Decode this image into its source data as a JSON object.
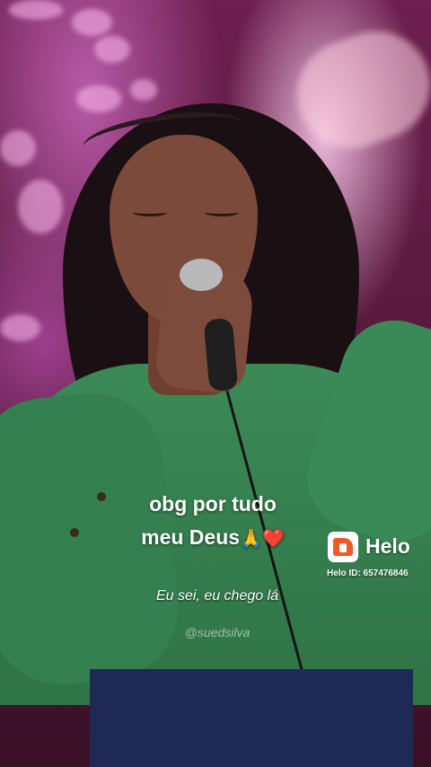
{
  "caption": {
    "line1": "obg por tudo",
    "line2": "meu Deus",
    "emoji_pray": "🙏",
    "emoji_heart": "❤️"
  },
  "video": {
    "subtitle": "Eu sei, eu chego lá",
    "handle": "@suedsilva"
  },
  "watermark": {
    "brand": "Helo",
    "id_text": "Helo ID: 657476846",
    "brand_color": "#ee5a24",
    "icon": "helo-logo-icon"
  }
}
